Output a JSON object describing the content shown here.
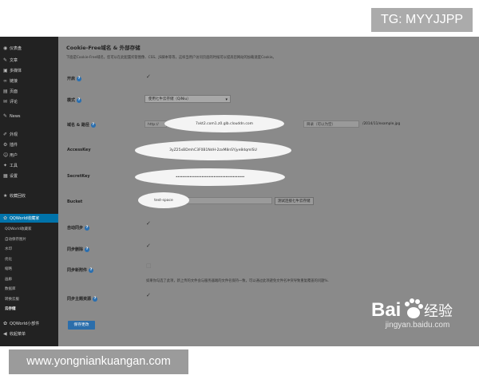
{
  "overlay": {
    "tag": "TG: MYYJJPP",
    "url": "www.yongniankuangan.com",
    "watermark_sub": "jingyan.baidu.com",
    "watermark_text": "Bai",
    "watermark_text2": "经验"
  },
  "sidebar": {
    "items": [
      {
        "label": "仪表盘",
        "icon": "dashboard-icon"
      },
      {
        "label": "文章",
        "icon": "pin-icon"
      },
      {
        "label": "多媒体",
        "icon": "media-icon"
      },
      {
        "label": "链接",
        "icon": "link-icon"
      },
      {
        "label": "页面",
        "icon": "page-icon"
      },
      {
        "label": "评论",
        "icon": "comment-icon"
      },
      {
        "label": "News",
        "icon": "pin-icon"
      },
      {
        "label": "外观",
        "icon": "brush-icon"
      },
      {
        "label": "插件",
        "icon": "plugin-icon"
      },
      {
        "label": "用户",
        "icon": "user-icon"
      },
      {
        "label": "工具",
        "icon": "wrench-icon"
      },
      {
        "label": "设置",
        "icon": "settings-icon"
      },
      {
        "label": "收藏回收",
        "icon": "star-icon"
      }
    ],
    "active": {
      "label": "QQWorld收藏家",
      "icon": "qq-icon"
    },
    "subitems": [
      "QQWorld收藏家",
      "自动保存图片",
      "水印",
      "优化",
      "缩略",
      "画廊",
      "数据库",
      "转换云服",
      "云存储"
    ],
    "bottom": [
      {
        "label": "QQWorld小部件",
        "icon": "widget-icon"
      },
      {
        "label": "收起菜单",
        "icon": "collapse-icon"
      }
    ]
  },
  "main": {
    "title": "Cookie-Free域名 & 外部存储",
    "desc": "下面是Cookie-Free域名，您可以在此配置托管图像、CSS、JS脚本等等，这样当用户访问页面的时候可以提高您网站的加载速度Cookie。",
    "fields": {
      "enable": {
        "label": "开启"
      },
      "mode": {
        "label": "模式",
        "value": "使用七牛云存储（QiNiu）"
      },
      "domain": {
        "label": "域名 & 路径",
        "protocol": "http://",
        "value": "7xkt2.com1.z0.glb.clouddn.com",
        "path_placeholder": "目录（可以为空）",
        "example": "/2014/11/example.jpg"
      },
      "accesskey": {
        "label": "AccessKey",
        "value": "3yZ25xBDmhC3F0B1NdH-2zxM8nSYjye8dqmISU"
      },
      "secretkey": {
        "label": "SecretKey",
        "value": "••••••••••••••••••••••••••••••••••••••••"
      },
      "bucket": {
        "label": "Bucket",
        "value": "test-space",
        "button": "测试连接七牛云存储"
      },
      "auto_sync": {
        "label": "自动同步"
      },
      "sync_delete": {
        "label": "同步删除"
      },
      "sync_new_attach": {
        "label": "同步新附件"
      },
      "note": "如果你勾选了此项，新上传的文件会与服务器端的文件名保持一致，可以通过此项避免文件名冲突导致重复覆盖的问题%."
    },
    "sync_theme": {
      "label": "同步主题资源"
    },
    "save_button": "保存更改"
  }
}
